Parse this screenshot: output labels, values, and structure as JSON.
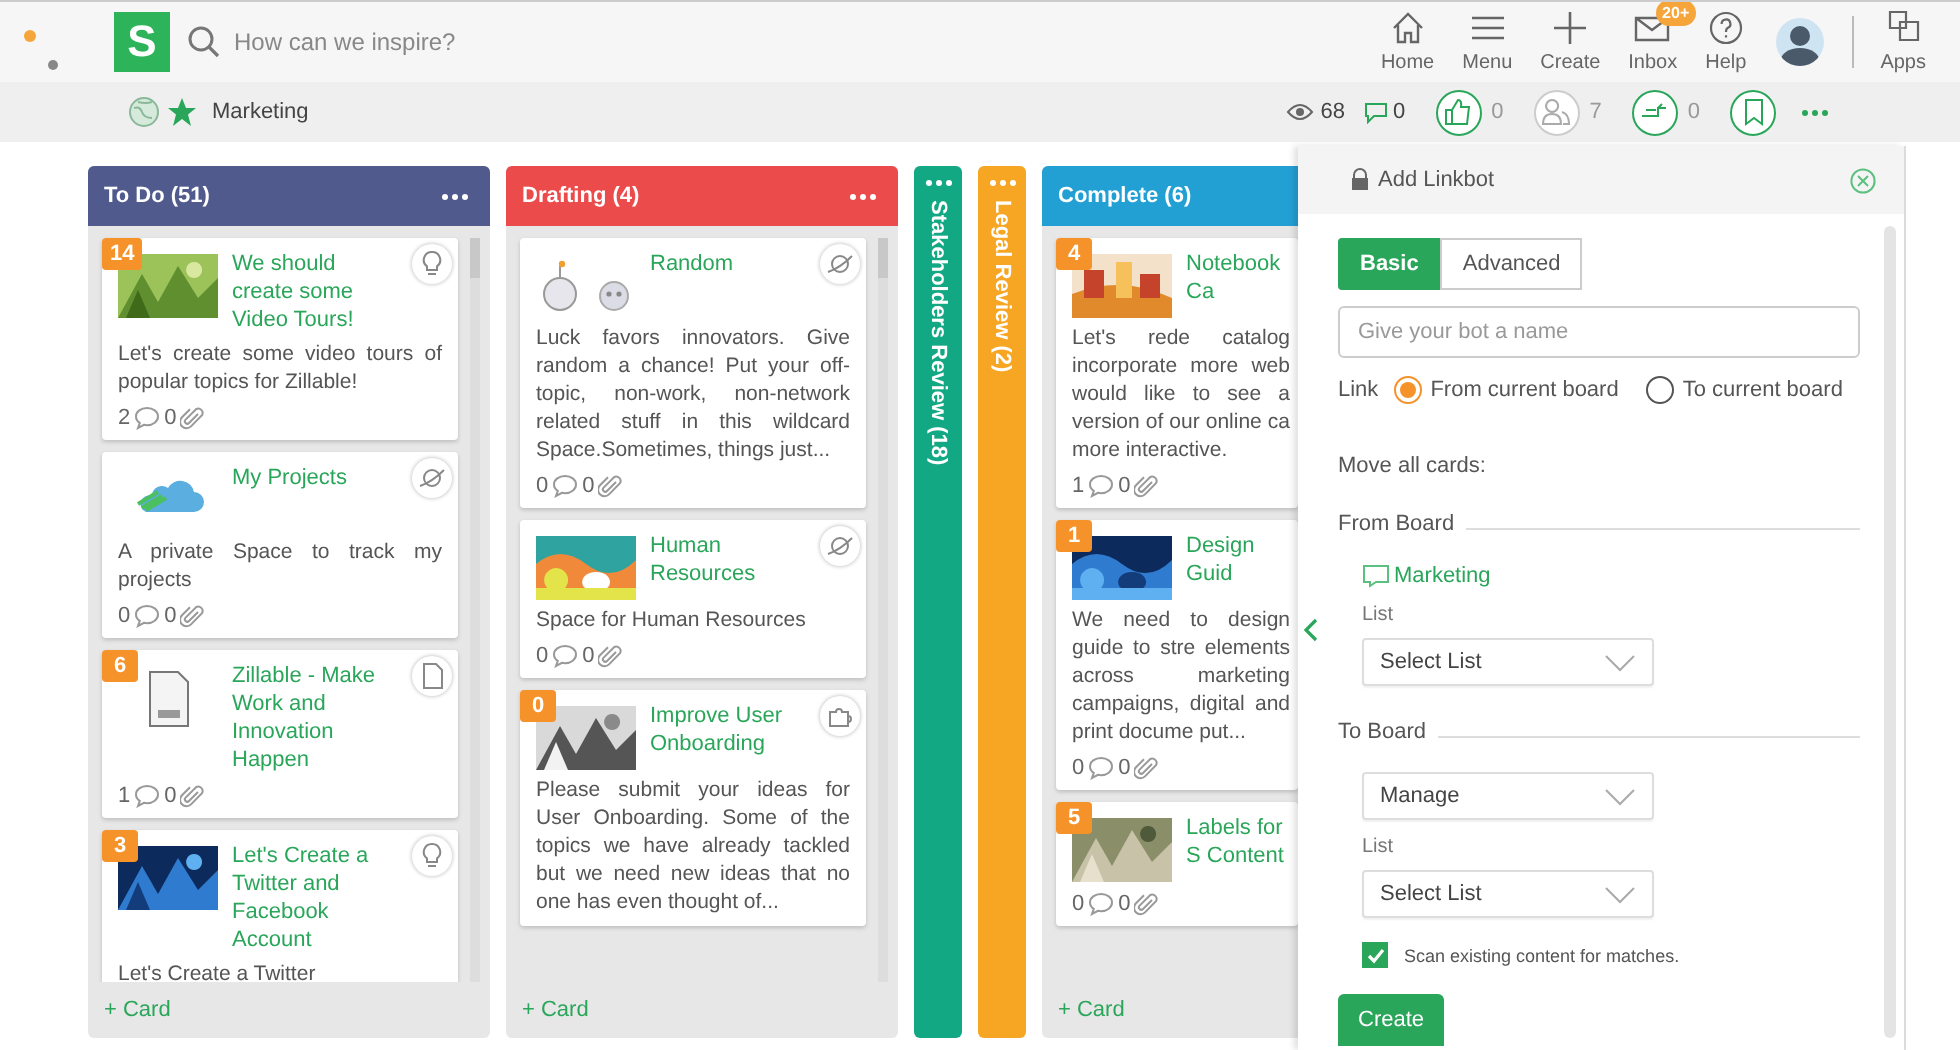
{
  "app": {
    "logo": "S",
    "search_placeholder": "How can we inspire?"
  },
  "nav": [
    {
      "kind": "link",
      "label": "Home"
    },
    {
      "kind": "link",
      "label": "Menu"
    },
    {
      "kind": "link",
      "label": "Create"
    },
    {
      "kind": "link",
      "label": "Inbox",
      "badge": "20+"
    },
    {
      "kind": "link",
      "label": "Help"
    },
    {
      "kind": "avatar"
    },
    {
      "kind": "link",
      "label": "Apps"
    }
  ],
  "board_bar": {
    "name": "Marketing",
    "views": "68",
    "comments": "0",
    "actions": [
      {
        "kind": "like",
        "count": "0"
      },
      {
        "kind": "members",
        "count": "7"
      },
      {
        "kind": "link",
        "count": "0"
      },
      {
        "kind": "bookmark"
      }
    ]
  },
  "columns": [
    {
      "title": "To Do (51)",
      "color": "#505a8c",
      "collapsed": false,
      "add_label": "+ Card",
      "cards": [
        {
          "badge": "14",
          "title": "We should create some Video Tours!",
          "text": "Let's create some video tours of popular topics for Zillable!",
          "comments": "2",
          "attachments": "0"
        },
        {
          "title": "My Projects",
          "text": "A private Space to track my projects",
          "comments": "0",
          "attachments": "0"
        },
        {
          "badge": "6",
          "title": "Zillable - Make Work and Innovation Happen",
          "comments": "1",
          "attachments": "0"
        },
        {
          "badge": "3",
          "title": "Let's Create a Twitter and Facebook Account",
          "text": "Let's Create a Twitter"
        }
      ]
    },
    {
      "title": "Drafting (4)",
      "color": "#eb4b4b",
      "collapsed": false,
      "add_label": "+ Card",
      "cards": [
        {
          "title": "Random",
          "text": "Luck favors innovators. Give random a chance! Put your off-topic, non-work, non-network related stuff in this wildcard Space.Sometimes, things just...",
          "comments": "0",
          "attachments": "0"
        },
        {
          "title": "Human Resources",
          "text": "Space for Human Resources",
          "comments": "0",
          "attachments": "0"
        },
        {
          "badge": "0",
          "title": "Improve User Onboarding",
          "text": "Please submit your ideas for User Onboarding. Some of the topics we have already tackled but we need new ideas that no one has even thought of..."
        }
      ]
    },
    {
      "title": "Stakeholders Review (18)",
      "color": "#13a884",
      "collapsed": true
    },
    {
      "title": "Legal Review (2)",
      "color": "#f6a623",
      "collapsed": true
    },
    {
      "title": "Complete (6)",
      "color": "#23a0d3",
      "collapsed": false,
      "add_label": "+ Card",
      "cards": [
        {
          "badge": "4",
          "title": "Notebook Ca",
          "text": "Let's rede catalog incorporate more web would like to see a version of our online ca more interactive.",
          "comments": "1",
          "attachments": "0"
        },
        {
          "badge": "1",
          "title": "Design Guid",
          "text": "We need to design guide to stre elements across marketing campaigns, digital and print docume put...",
          "comments": "0",
          "attachments": "0"
        },
        {
          "badge": "5",
          "title": "Labels for S Content",
          "comments": "0",
          "attachments": "0"
        }
      ]
    }
  ],
  "panel": {
    "title": "Add Linkbot",
    "tabs": [
      {
        "label": "Basic",
        "selected": true
      },
      {
        "label": "Advanced",
        "selected": false
      }
    ],
    "name_placeholder": "Give your bot a name",
    "link_label": "Link",
    "link_options": [
      {
        "label": "From current board",
        "selected": true
      },
      {
        "label": "To current board",
        "selected": false
      }
    ],
    "move_label": "Move all cards:",
    "from_board": {
      "heading": "From Board",
      "board": "Marketing",
      "list_label": "List",
      "list_value": "Select List"
    },
    "to_board": {
      "heading": "To Board",
      "board_value": "Manage",
      "list_label": "List",
      "list_value": "Select List"
    },
    "scan": {
      "label": "Scan existing content for matches.",
      "checked": true
    },
    "create_label": "Create"
  }
}
